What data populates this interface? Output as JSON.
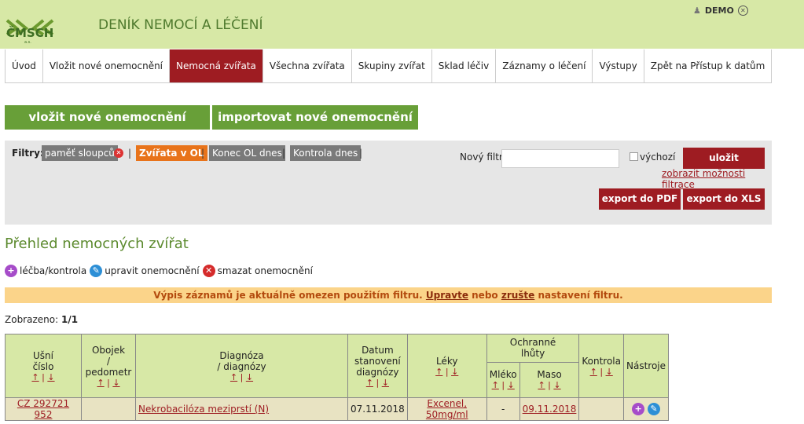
{
  "header": {
    "logo_text": "ČMSCH",
    "logo_sub": "a.s.",
    "app_title": "DENÍK NEMOCÍ A LÉČENÍ",
    "user_name": "DEMO",
    "user_icon": "user-icon",
    "logout_icon": "close-circle-icon"
  },
  "nav": {
    "tabs": [
      "Úvod",
      "Vložit nové onemocnění",
      "Nemocná zvířata",
      "Všechna zvířata",
      "Skupiny zvířat",
      "Sklad léčiv",
      "Záznamy o léčení",
      "Výstupy",
      "Zpět na Přístup k datům"
    ],
    "active": "Nemocná zvířata"
  },
  "actions": {
    "insert": "vložit nové onemocnění",
    "import": "importovat nové onemocnění"
  },
  "filters": {
    "label": "Filtry:",
    "chips": [
      "paměť sloupců",
      "Zvířata v OL",
      "Konec OL dnes",
      "Kontrola dnes"
    ],
    "separator": "|",
    "new_filter_label": "Nový filtr:",
    "new_filter_value": "",
    "default_label": "výchozí",
    "save": "uložit",
    "show_options": "zobrazit možnosti filtrace",
    "export_pdf": "export do PDF",
    "export_xls": "export do XLS"
  },
  "section_title": "Přehled nemocných zvířat",
  "legend": {
    "treat": "léčba/kontrola",
    "edit": "upravit onemocnění",
    "delete": "smazat onemocnění"
  },
  "notice": {
    "part1": "Výpis záznamů je aktuálně omezen použitím filtru.",
    "link1": "Upravte",
    "part2": "nebo",
    "link2": "zrušte",
    "part3": "nastavení filtru."
  },
  "shown": {
    "label": "Zobrazeno:",
    "value": "1/1"
  },
  "table": {
    "headers": {
      "ear_1": "Ušní",
      "ear_2": "číslo",
      "collar_1": "Obojek",
      "collar_2": "/",
      "collar_3": "pedometr",
      "diag_1": "Diagnóza",
      "diag_2": "/ diagnózy",
      "date_1": "Datum",
      "date_2": "stanovení",
      "date_3": "diagnózy",
      "drugs": "Léky",
      "protect_1": "Ochranné",
      "protect_2": "lhůty",
      "milk": "Mléko",
      "meat": "Maso",
      "control": "Kontrola",
      "tools": "Nástroje"
    },
    "sort_up": "↑",
    "sort_sep": "|",
    "sort_down": "↓",
    "rows": [
      {
        "ear": "CZ 292721 952",
        "collar": "",
        "diagnosis": "Nekrobacilóza meziprstí (N)",
        "date": "07.11.2018",
        "drugs": "Excenel, 50mg/ml",
        "milk": "-",
        "meat": "09.11.2018",
        "control": ""
      }
    ]
  }
}
